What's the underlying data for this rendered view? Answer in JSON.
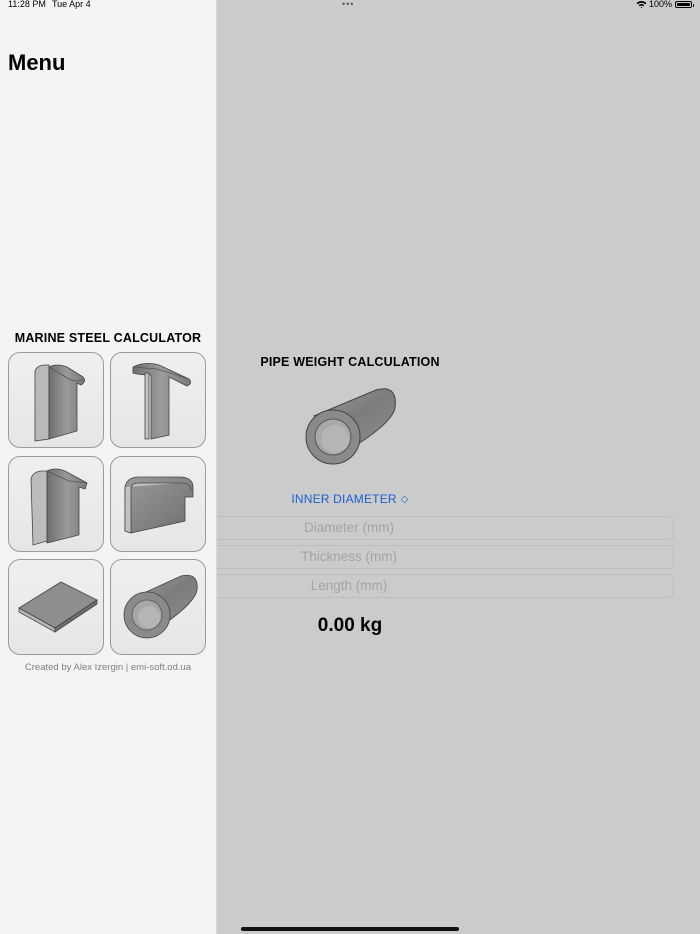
{
  "status_bar": {
    "time": "11:28 PM",
    "date": "Tue Apr 4",
    "battery": "100%",
    "multitask_dots": "•••"
  },
  "sidebar": {
    "title": "Menu",
    "section_title": "MARINE STEEL CALCULATOR",
    "tiles": [
      {
        "icon": "angle-bulb-profile-icon"
      },
      {
        "icon": "t-bulb-profile-icon"
      },
      {
        "icon": "angle-profile-icon"
      },
      {
        "icon": "bulb-flat-profile-icon"
      },
      {
        "icon": "steel-plate-icon"
      },
      {
        "icon": "pipe-icon"
      }
    ],
    "credit": "Created by Alex Izergin | emi-soft.od.ua"
  },
  "main": {
    "title": "PIPE WEIGHT CALCULATION",
    "mode_label": "INNER DIAMETER",
    "mode_chevron": "◇",
    "fields": {
      "diameter_placeholder": "Diameter (mm)",
      "thickness_placeholder": "Thickness (mm)",
      "length_placeholder": "Length (mm)"
    },
    "result": "0.00 kg"
  },
  "colors": {
    "accent": "#1a5fd0",
    "sidebar_bg": "#f4f4f4",
    "main_bg": "#cbcbcb"
  }
}
